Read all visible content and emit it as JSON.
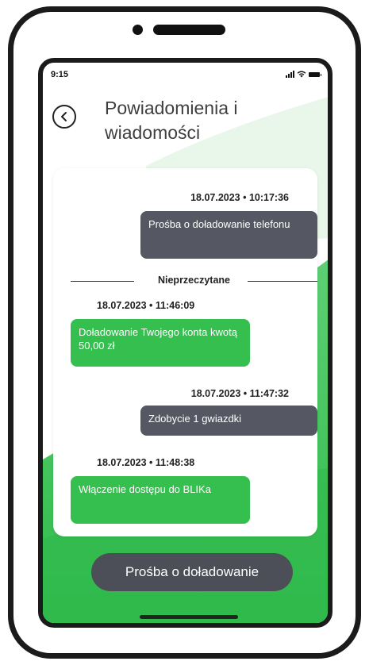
{
  "status_bar": {
    "time": "9:15"
  },
  "header": {
    "title": "Powiadomienia i wiadomości"
  },
  "divider_label": "Nieprzeczytane",
  "messages": [
    {
      "timestamp": "18.07.2023 • 10:17:36",
      "text": "Prośba o doładowanie telefonu",
      "kind": "outgoing"
    },
    {
      "timestamp": "18.07.2023 • 11:46:09",
      "text": "Doładowanie Twojego konta kwotą 50,00 zł",
      "kind": "incoming"
    },
    {
      "timestamp": "18.07.2023 • 11:47:32",
      "text": "Zdobycie 1 gwiazdki",
      "kind": "outgoing"
    },
    {
      "timestamp": "18.07.2023 • 11:48:38",
      "text": "Włączenie dostępu do BLIKa",
      "kind": "incoming"
    }
  ],
  "action_button": {
    "label": "Prośba o doładowanie"
  },
  "colors": {
    "incoming_bubble": "#35bf4f",
    "outgoing_bubble": "#555762",
    "background_green": "#3dc356",
    "button": "#4d4f58"
  },
  "icons": {
    "back": "back-arrow-circle-icon",
    "signal": "signal-icon",
    "wifi": "wifi-icon",
    "battery": "battery-icon"
  }
}
